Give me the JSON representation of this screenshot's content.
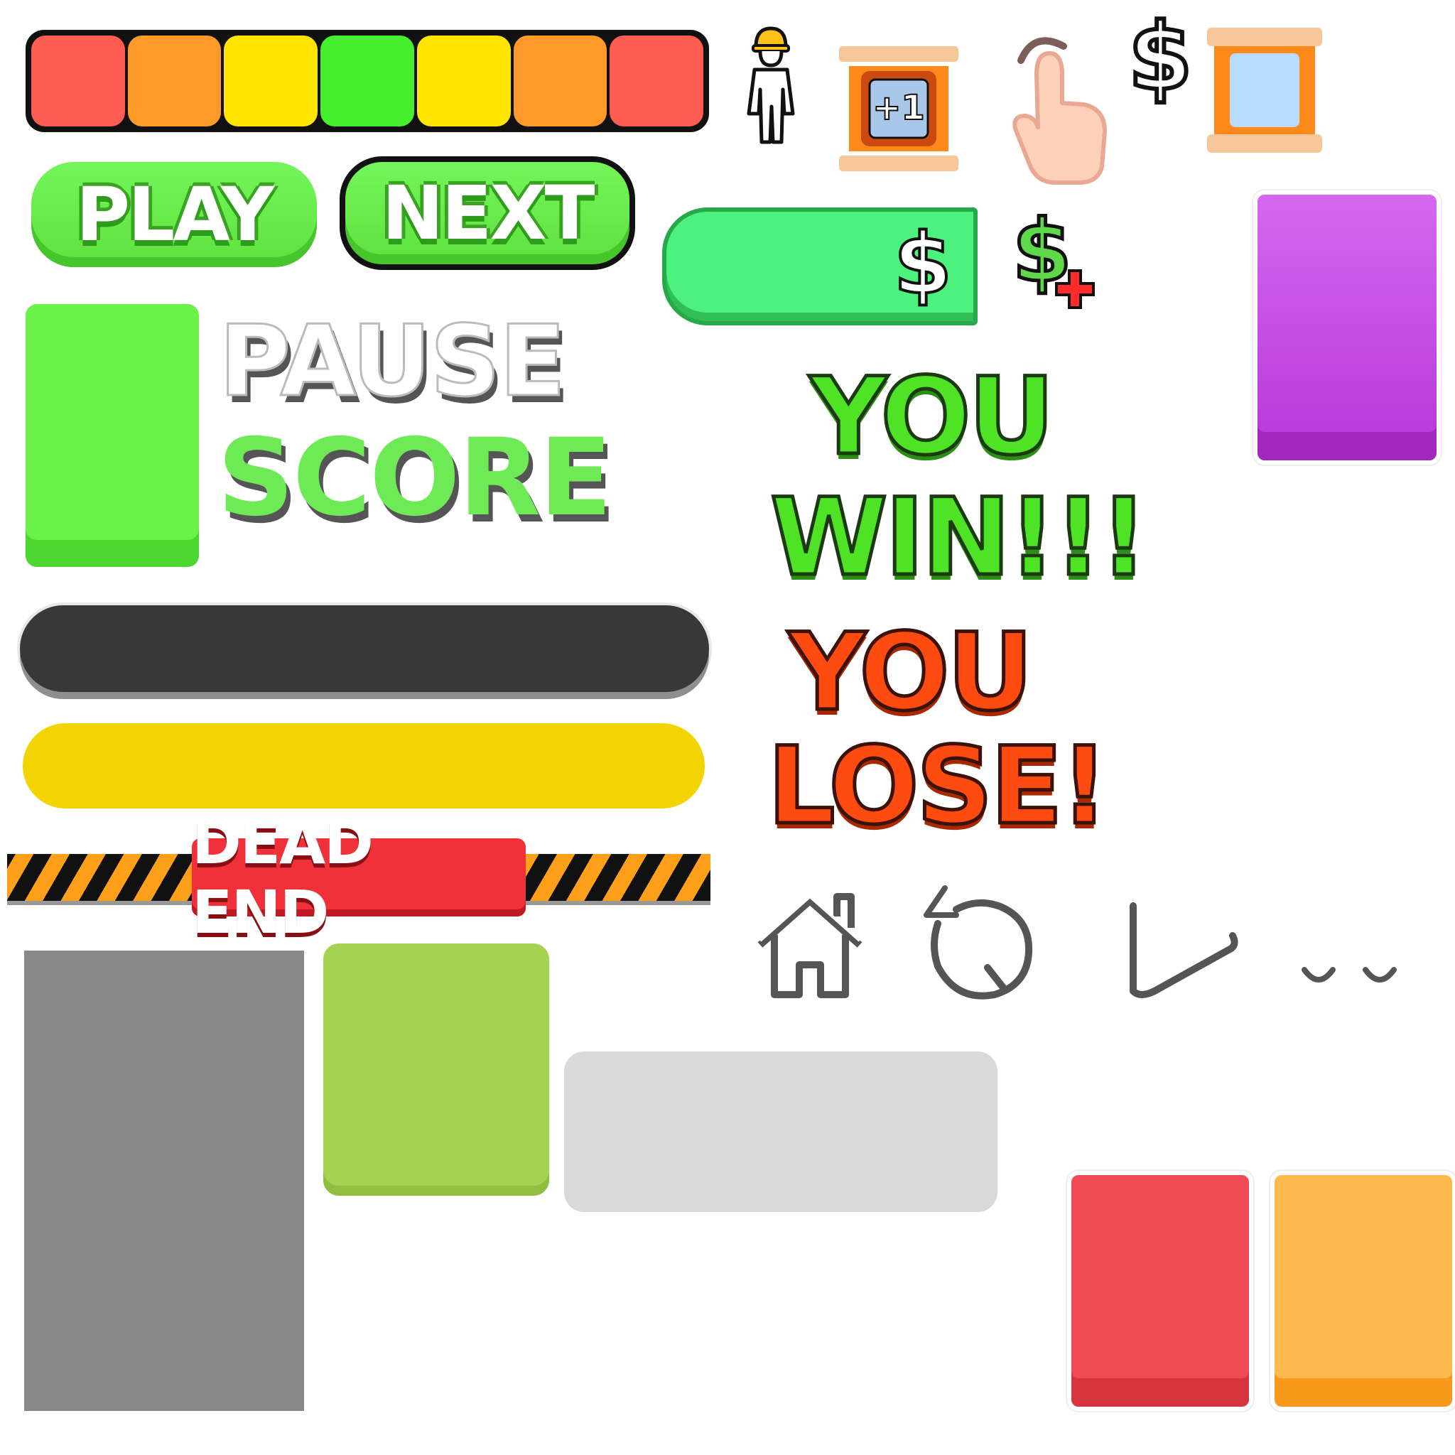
{
  "meter": {
    "segments": [
      "#ff5c52",
      "#ff9a2a",
      "#ffe500",
      "#45ef2e",
      "#ffe500",
      "#ff9a2a",
      "#ff5c52"
    ]
  },
  "buttons": {
    "play_label": "PLAY",
    "next_label": "NEXT",
    "money_label": "$"
  },
  "labels": {
    "pause": "PAUSE",
    "score": "SCORE",
    "dead_end": "DEAD END",
    "you_win_line1": "YOU",
    "you_win_line2": "WIN!!!",
    "you_lose_line1": "YOU",
    "you_lose_line2": "LOSE!",
    "plus_one": "+1",
    "dollar": "$"
  },
  "icons": [
    "worker-icon",
    "plus-one-crate-icon",
    "tap-hand-icon",
    "dollar-icon",
    "frame-crate-icon",
    "dollar-plus-icon",
    "home-icon",
    "restart-icon",
    "check-icon",
    "more-dots-icon"
  ],
  "colors": {
    "green": "#5ee23e",
    "purple": "#c452e0",
    "red": "#f04a57",
    "orange": "#fdb84e",
    "gray": "#878787",
    "yellow": "#f2d500",
    "dark": "#383838"
  }
}
